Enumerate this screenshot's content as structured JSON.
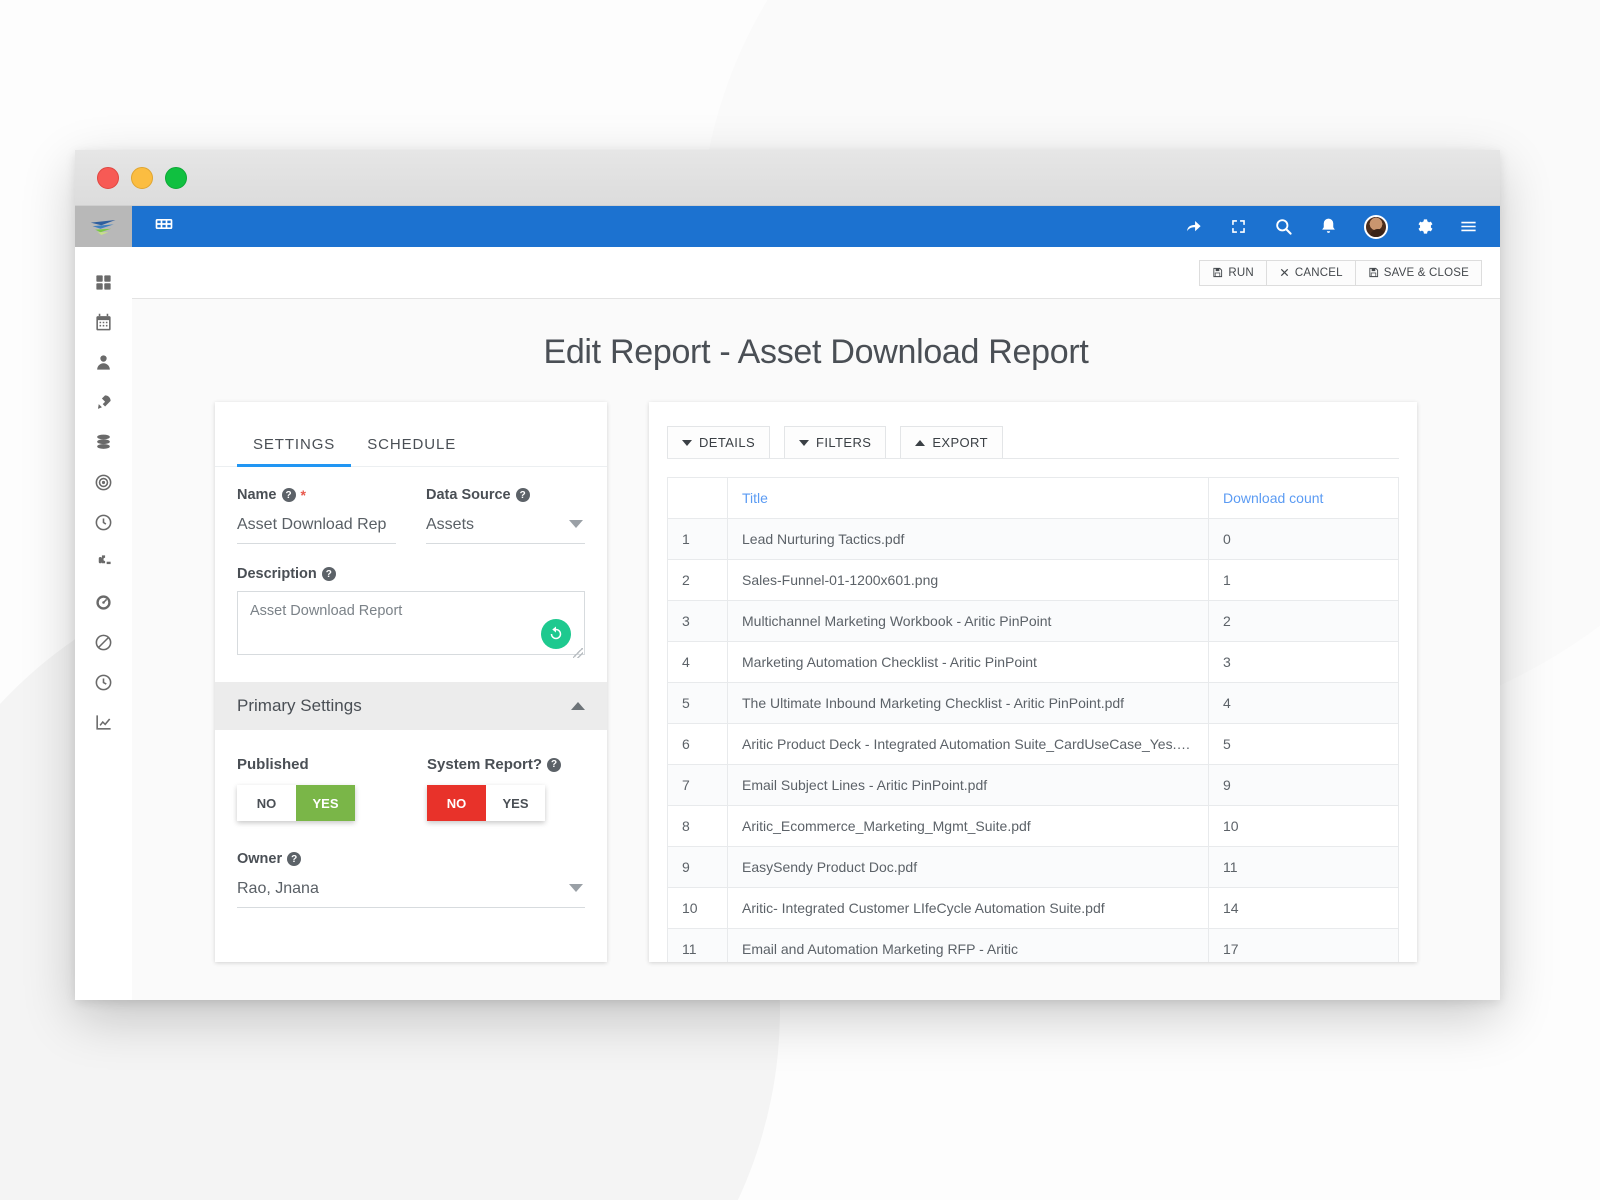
{
  "window": {
    "traffic_lights": [
      "close",
      "minimize",
      "zoom"
    ]
  },
  "topbar": {
    "menu_icon": "grid-menu-icon",
    "icons": [
      "share-arrow-icon",
      "fullscreen-icon",
      "search-icon",
      "bell-icon",
      "avatar",
      "gear-icon",
      "hamburger-icon"
    ],
    "color": "#1c72d0"
  },
  "sidebar": {
    "items": [
      {
        "icon": "dashboard-grid-icon"
      },
      {
        "icon": "calendar-icon"
      },
      {
        "icon": "contact-person-icon"
      },
      {
        "icon": "rocket-icon"
      },
      {
        "icon": "database-icon"
      },
      {
        "icon": "target-icon"
      },
      {
        "icon": "clock-icon"
      },
      {
        "icon": "puzzle-icon"
      },
      {
        "icon": "gauge-icon"
      },
      {
        "icon": "blocked-icon"
      },
      {
        "icon": "clock-alt-icon"
      },
      {
        "icon": "trending-chart-icon"
      }
    ]
  },
  "actionbar": {
    "run_label": "RUN",
    "cancel_label": "CANCEL",
    "save_label": "SAVE & CLOSE"
  },
  "page": {
    "title": "Edit Report - Asset Download Report"
  },
  "settings": {
    "tabs": [
      {
        "label": "SETTINGS",
        "active": true
      },
      {
        "label": "SCHEDULE",
        "active": false
      }
    ],
    "name": {
      "label": "Name",
      "required": "*",
      "value": "Asset Download Rep"
    },
    "data_source": {
      "label": "Data Source",
      "value": "Assets"
    },
    "description": {
      "label": "Description",
      "value": "Asset Download Report",
      "refresh_icon": "refresh-icon"
    },
    "primary_settings": {
      "header": "Primary Settings",
      "published": {
        "label": "Published",
        "no": "NO",
        "yes": "YES",
        "selected": "YES",
        "on_color": "#7ab648"
      },
      "system_report": {
        "label": "System Report?",
        "no": "NO",
        "yes": "YES",
        "selected": "NO",
        "on_color": "#e8322a"
      },
      "owner": {
        "label": "Owner",
        "value": "Rao, Jnana"
      }
    }
  },
  "report": {
    "toolbar": [
      {
        "label": "DETAILS",
        "caret": "down"
      },
      {
        "label": "FILTERS",
        "caret": "down"
      },
      {
        "label": "EXPORT",
        "caret": "up"
      }
    ],
    "columns": [
      "",
      "Title",
      "Download count"
    ],
    "rows": [
      {
        "idx": "1",
        "title": "Lead Nurturing Tactics.pdf",
        "count": "0"
      },
      {
        "idx": "2",
        "title": "Sales-Funnel-01-1200x601.png",
        "count": "1"
      },
      {
        "idx": "3",
        "title": "Multichannel Marketing Workbook - Aritic PinPoint",
        "count": "2"
      },
      {
        "idx": "4",
        "title": "Marketing Automation Checklist - Aritic PinPoint",
        "count": "3"
      },
      {
        "idx": "5",
        "title": "The Ultimate Inbound Marketing Checklist - Aritic PinPoint.pdf",
        "count": "4"
      },
      {
        "idx": "6",
        "title": "Aritic Product Deck - Integrated Automation Suite_CardUseCase_Yes.pdf",
        "count": "5"
      },
      {
        "idx": "7",
        "title": "Email Subject Lines - Aritic PinPoint.pdf",
        "count": "9"
      },
      {
        "idx": "8",
        "title": "Aritic_Ecommerce_Marketing_Mgmt_Suite.pdf",
        "count": "10"
      },
      {
        "idx": "9",
        "title": "EasySendy Product Doc.pdf",
        "count": "11"
      },
      {
        "idx": "10",
        "title": "Aritic- Integrated Customer LIfeCycle Automation Suite.pdf",
        "count": "14"
      },
      {
        "idx": "11",
        "title": "Email and Automation Marketing RFP - Aritic",
        "count": "17"
      }
    ]
  }
}
